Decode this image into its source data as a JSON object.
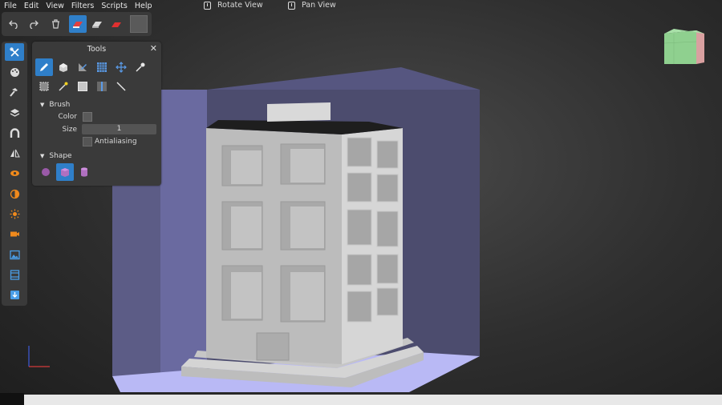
{
  "menu": [
    "File",
    "Edit",
    "View",
    "Filters",
    "Scripts",
    "Help"
  ],
  "view_buttons": {
    "rotate": "Rotate View",
    "pan": "Pan View"
  },
  "toolbar": {
    "undo": "undo-icon",
    "redo": "redo-icon",
    "delete": "trash-icon",
    "brush_modes": [
      "eraser-red-icon",
      "eraser-gray-icon",
      "eraser-flat-red-icon"
    ]
  },
  "dock": [
    "tools-icon",
    "palette-icon",
    "hammer-icon",
    "layers-icon",
    "magnet-icon",
    "mirror-icon",
    "eye-icon",
    "contrast-icon",
    "light-icon",
    "camera-icon",
    "image-icon",
    "film-icon",
    "download-icon"
  ],
  "tools_panel": {
    "title": "Tools",
    "brush_section": "Brush",
    "color_label": "Color",
    "size_label": "Size",
    "size_value": "1",
    "antialiasing_label": "Antialiasing",
    "shape_section": "Shape"
  },
  "colors": {
    "accent": "#2f7fc9",
    "panel": "#3a3a3a",
    "floor": "#b8b8ff",
    "backwall": "#6a6a9c"
  }
}
